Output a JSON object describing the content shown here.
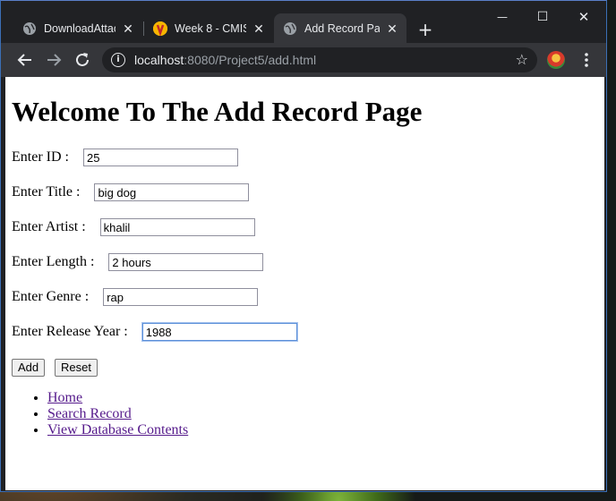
{
  "browser": {
    "tabs": [
      {
        "title": "DownloadAttac",
        "close": "✕"
      },
      {
        "title": "Week 8 - CMIS",
        "close": "✕"
      },
      {
        "title": "Add Record Pa",
        "close": "✕"
      }
    ],
    "new_tab": "+",
    "window_controls": {
      "minimize": "—",
      "maximize": "☐",
      "close": "✕"
    },
    "url_host": "localhost",
    "url_rest": ":8080/Project5/add.html",
    "accent_color": "#35363a"
  },
  "page": {
    "heading": "Welcome To The Add Record Page",
    "fields": [
      {
        "label": "Enter ID :",
        "value": "25"
      },
      {
        "label": "Enter Title :",
        "value": "big dog"
      },
      {
        "label": "Enter Artist :",
        "value": "khalil"
      },
      {
        "label": "Enter Length :",
        "value": "2 hours"
      },
      {
        "label": "Enter Genre :",
        "value": "rap"
      },
      {
        "label": "Enter Release Year :",
        "value": "1988"
      }
    ],
    "add_label": "Add",
    "reset_label": "Reset",
    "links": [
      "Home",
      "Search Record",
      "View Database Contents"
    ]
  }
}
